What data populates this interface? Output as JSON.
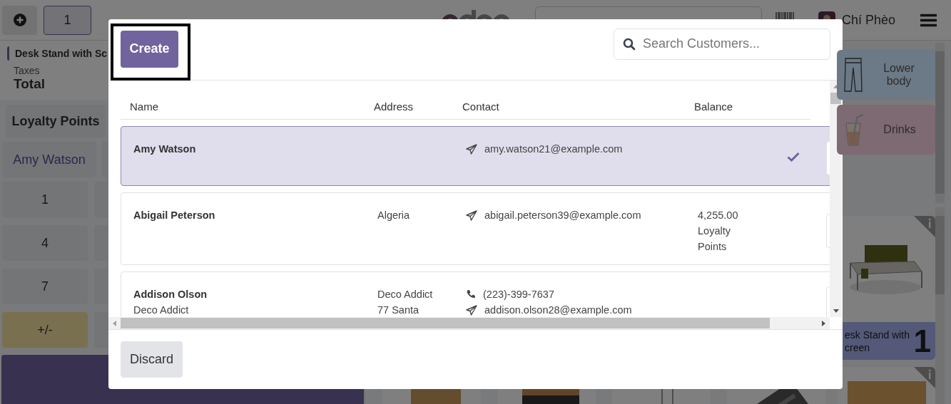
{
  "topbar": {
    "order_count": "1",
    "user": "Chí Phèo"
  },
  "order": {
    "line": "Desk Stand with Sc",
    "taxes_label": "Taxes",
    "total_label": "Total"
  },
  "actions": {
    "loyalty": "Loyalty Points",
    "customer": "Amy Watson"
  },
  "numpad": [
    "1",
    "4",
    "7",
    "+/-"
  ],
  "categories": [
    {
      "label": "Lower body",
      "kind": "pants",
      "color": "#6c7986"
    },
    {
      "label": "Drinks",
      "kind": "cup",
      "color": "#7d6a72"
    }
  ],
  "product": {
    "name": "esk Stand with\ncreen",
    "quantity": "1"
  },
  "dialog": {
    "create": "Create",
    "search_placeholder": "Search Customers...",
    "columns": [
      "Name",
      "Address",
      "Contact",
      "Balance"
    ],
    "rows": [
      {
        "name": "Amy Watson",
        "selected": true,
        "contact": [
          {
            "kind": "email",
            "text": "amy.watson21@example.com"
          }
        ]
      },
      {
        "name": "Abigail Peterson",
        "selected": false,
        "address": [
          "Algeria"
        ],
        "contact": [
          {
            "kind": "email",
            "text": "abigail.peterson39@example.com"
          }
        ],
        "balance": "4,255.00 Loyalty Points"
      },
      {
        "name": "Addison Olson",
        "company": "Deco Addict",
        "selected": false,
        "address": [
          "Deco Addict",
          "77 Santa"
        ],
        "contact": [
          {
            "kind": "phone",
            "text": "(223)-399-7637"
          },
          {
            "kind": "email",
            "text": "addison.olson28@example.com"
          }
        ]
      }
    ],
    "discard": "Discard"
  }
}
